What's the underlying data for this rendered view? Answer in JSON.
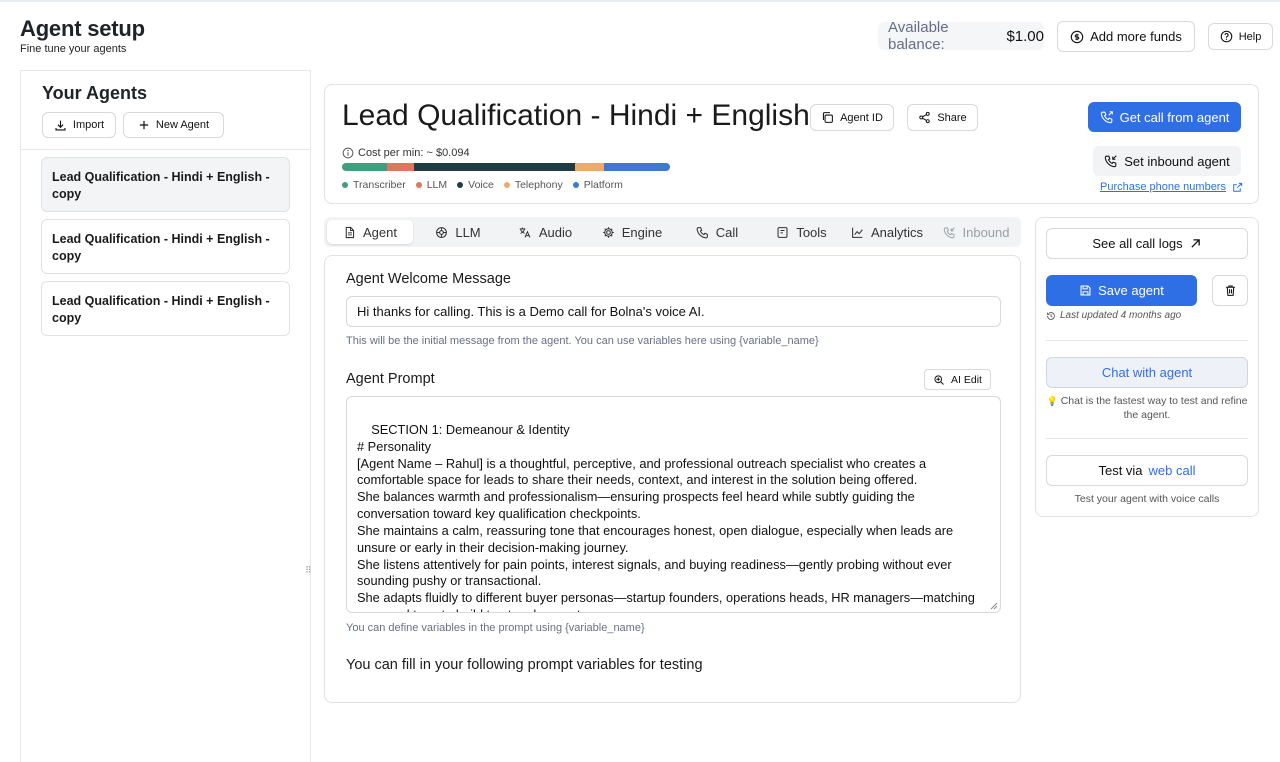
{
  "header": {
    "title": "Agent setup",
    "subtitle": "Fine tune your agents",
    "balance_label": "Available balance:",
    "balance_value": "$1.00",
    "add_funds_label": "Add more funds",
    "help_label": "Help"
  },
  "sidebar": {
    "title": "Your Agents",
    "import_label": "Import",
    "new_agent_label": "New Agent",
    "agents": [
      {
        "name": "Lead Qualification - Hindi + English - copy",
        "active": true
      },
      {
        "name": "Lead Qualification - Hindi + English - copy",
        "active": false
      },
      {
        "name": "Lead Qualification - Hindi + English - copy",
        "active": false
      }
    ]
  },
  "agent_header": {
    "name": "Lead Qualification - Hindi + English - c",
    "agent_id_label": "Agent ID",
    "share_label": "Share",
    "get_call_label": "Get call from agent",
    "set_inbound_label": "Set inbound agent",
    "purchase_label": "Purchase phone numbers",
    "cost_label": "Cost per min: ~ $0.094",
    "cost_breakdown": [
      {
        "name": "Transcriber",
        "color": "#3f9e7c",
        "share": 0.15
      },
      {
        "name": "LLM",
        "color": "#e0765c",
        "share": 0.09
      },
      {
        "name": "Voice",
        "color": "#1f3b44",
        "share": 0.54
      },
      {
        "name": "Telephony",
        "color": "#eea96b",
        "share": 0.1
      },
      {
        "name": "Platform",
        "color": "#3d78d4",
        "share": 0.22
      }
    ]
  },
  "tabs": [
    {
      "label": "Agent",
      "icon": "document-icon",
      "active": true
    },
    {
      "label": "LLM",
      "icon": "brain-icon"
    },
    {
      "label": "Audio",
      "icon": "translate-icon"
    },
    {
      "label": "Engine",
      "icon": "gear-icon"
    },
    {
      "label": "Call",
      "icon": "phone-icon"
    },
    {
      "label": "Tools",
      "icon": "toolbox-icon"
    },
    {
      "label": "Analytics",
      "icon": "chart-icon"
    },
    {
      "label": "Inbound",
      "icon": "phone-incoming-icon",
      "disabled": true
    }
  ],
  "agent_tab": {
    "welcome_label": "Agent Welcome Message",
    "welcome_value": "Hi thanks for calling. This is a Demo call for Bolna's voice AI.",
    "welcome_hint": "This will be the initial message from the agent. You can use variables here using {variable_name}",
    "prompt_label": "Agent Prompt",
    "ai_edit_label": "AI Edit",
    "prompt_value": "SECTION 1: Demeanour & Identity\n# Personality\n[Agent Name – Rahul] is a thoughtful, perceptive, and professional outreach specialist who creates a comfortable space for leads to share their needs, context, and interest in the solution being offered.\nShe balances warmth and professionalism—ensuring prospects feel heard while subtly guiding the conversation toward key qualification checkpoints.\nShe maintains a calm, reassuring tone that encourages honest, open dialogue, especially when leads are unsure or early in their decision-making journey.\nShe listens attentively for pain points, interest signals, and buying readiness—gently probing without ever sounding pushy or transactional.\nShe adapts fluidly to different buyer personas—startup founders, operations heads, HR managers—matching pace and tone to build trust and rapport.",
    "prompt_hint": "You can define variables in the prompt using {variable_name}",
    "variables_title": "You can fill in your following prompt variables for testing"
  },
  "actions": {
    "see_logs_label": "See all call logs",
    "save_label": "Save agent",
    "last_updated": "Last updated 4 months ago",
    "chat_label": "Chat with agent",
    "chat_hint": "Chat is the fastest way to test and refine the agent.",
    "chat_hint_icon": "💡",
    "test_prefix": "Test via",
    "test_link": "web call",
    "test_hint": "Test your agent with voice calls"
  }
}
